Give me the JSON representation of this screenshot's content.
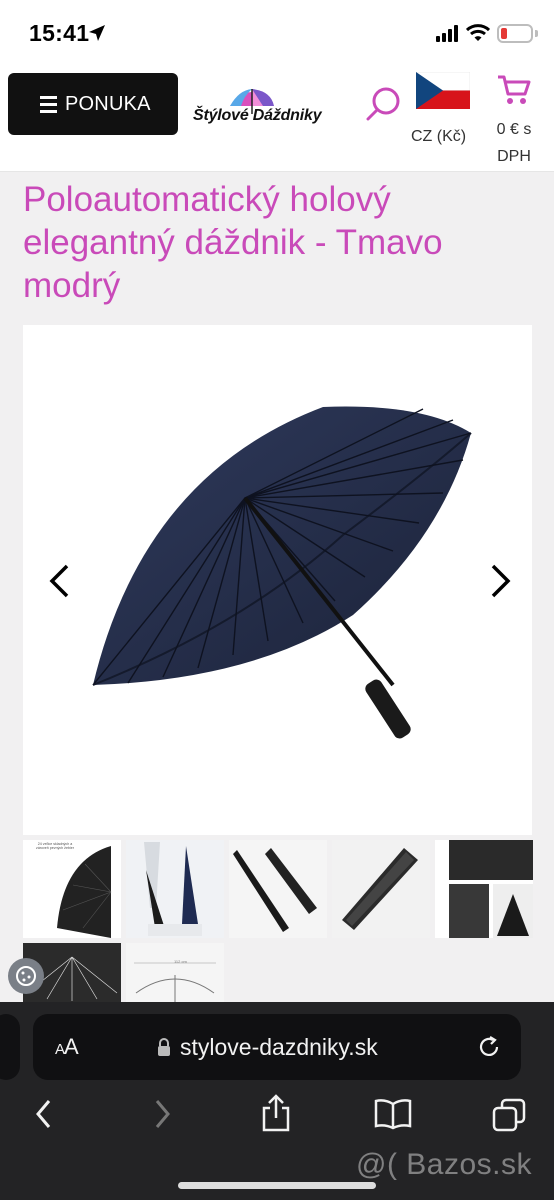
{
  "status_bar": {
    "time": "15:41"
  },
  "header": {
    "menu_label": "PONUKA",
    "logo_text": "Štýlové Dáždniky",
    "currency": "CZ (Kč)",
    "cart_total": "0 € s DPH",
    "accent_color": "#c94ab9"
  },
  "product": {
    "title": "Poloautomatický holový elegantný dáždnik - Tmavo modrý",
    "thumbnail_1_caption": "24 veľice skladných a zároveň pevných žebier",
    "thumbnail_7_dimension": "112 cm"
  },
  "browser": {
    "aa_label_small": "A",
    "aa_label_large": "A",
    "url": "stylove-dazdniky.sk"
  },
  "watermark": "@( Bazos.sk",
  "icons": [
    "location-arrow-icon",
    "signal-icon",
    "wifi-icon",
    "battery-icon",
    "hamburger-icon",
    "search-icon",
    "czech-flag-icon",
    "cart-icon",
    "chevron-left-icon",
    "chevron-right-icon",
    "cookie-icon",
    "lock-icon",
    "reload-icon",
    "back-icon",
    "forward-icon",
    "share-icon",
    "bookmarks-icon",
    "tabs-icon"
  ]
}
